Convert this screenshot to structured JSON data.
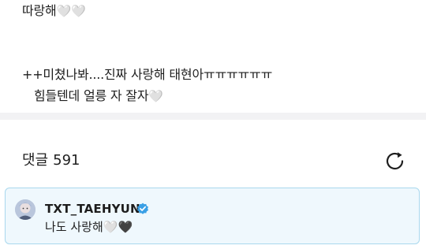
{
  "post": {
    "line1_text": "따랑해",
    "line1_hearts": [
      "🤍",
      "🤍"
    ],
    "line2_text": "++미쳤나봐....진짜 사랑해 태현아ㅠㅠㅠㅠㅠㅠ",
    "line3_text": "힘들텐데 얼릉 자 잘자",
    "line3_hearts": [
      "🤍"
    ]
  },
  "comments": {
    "label": "댓글",
    "count": "591",
    "refresh_icon": "refresh-icon"
  },
  "pinned_comment": {
    "author": "TXT_TAEHYUN",
    "verified_icon": "verified-badge-icon",
    "text": "나도 사랑해",
    "hearts": [
      "🤍",
      "🖤"
    ],
    "colors": {
      "card_background": "#eff8fd",
      "card_border": "#a9d8ee",
      "verified": "#3aa0e6"
    }
  }
}
